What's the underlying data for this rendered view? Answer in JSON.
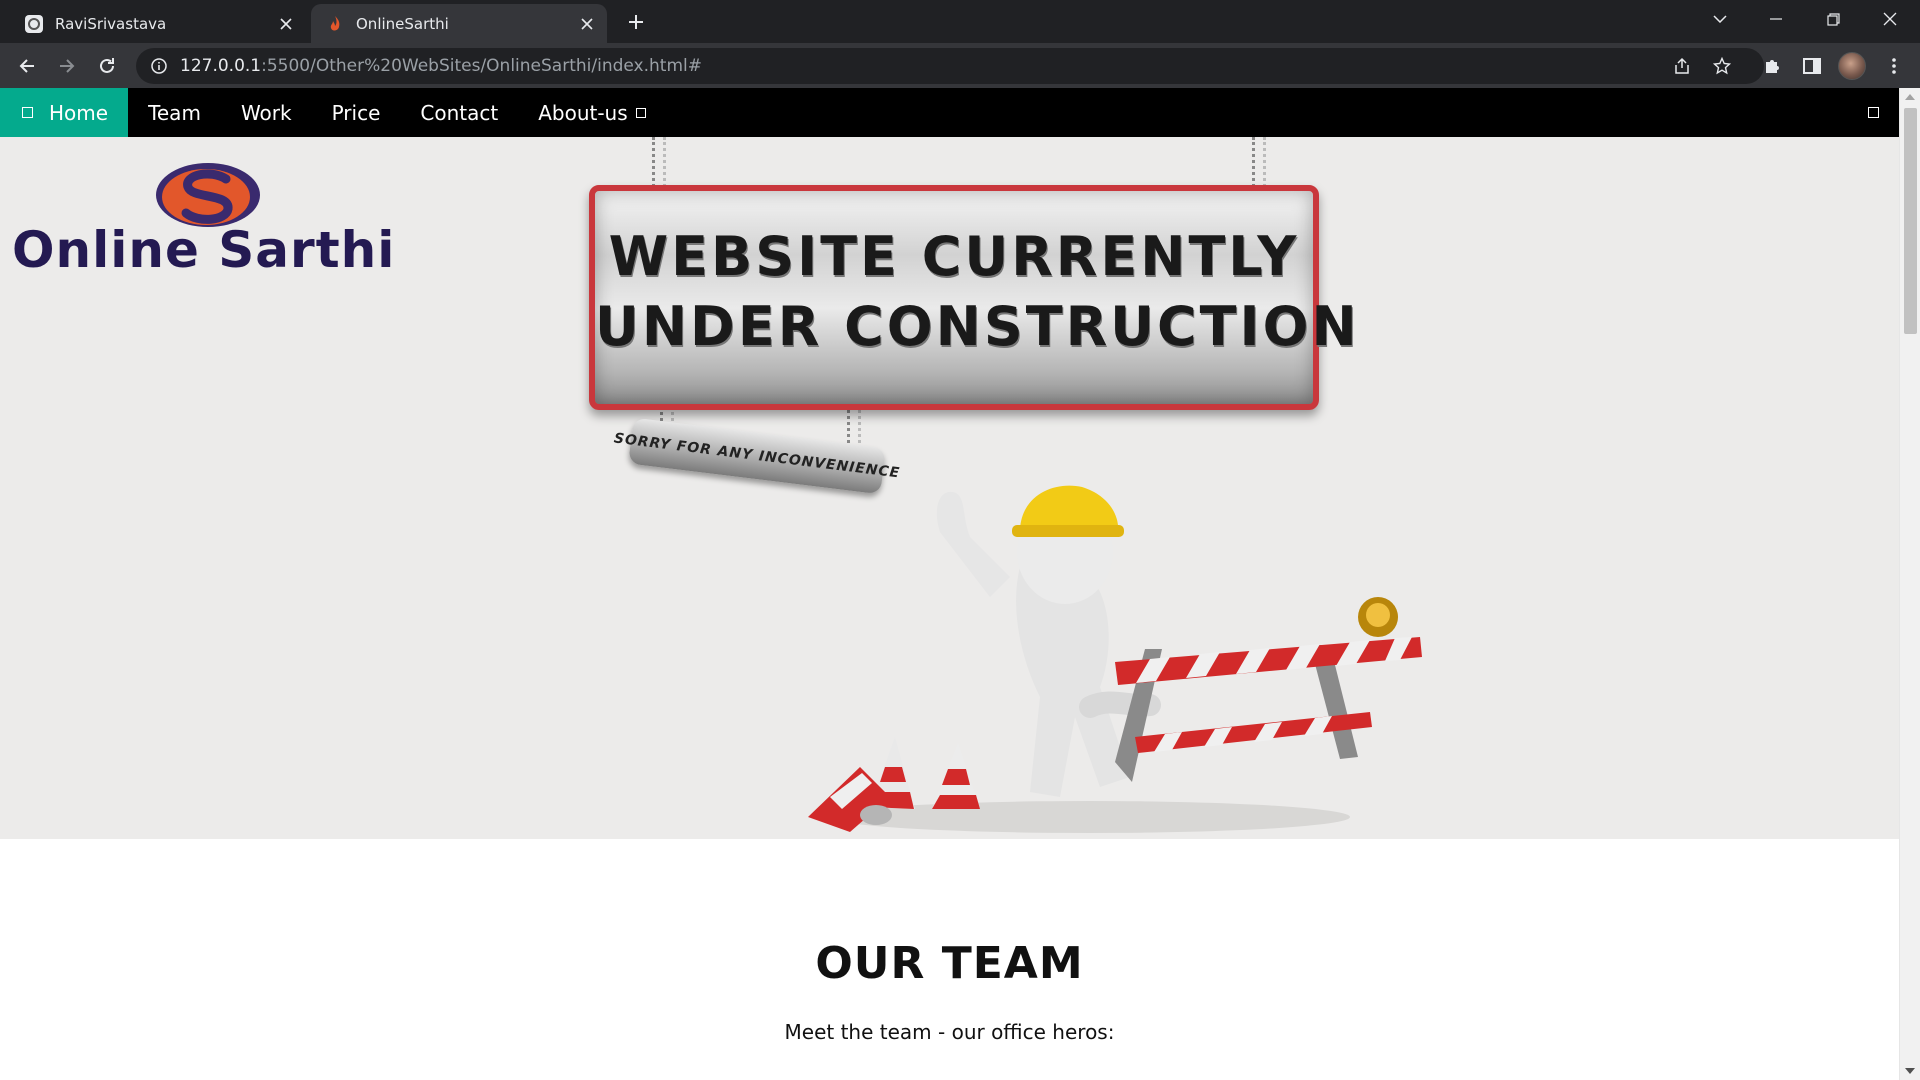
{
  "browser": {
    "tabs": [
      {
        "title": "RaviSrivastava",
        "active": false
      },
      {
        "title": "OnlineSarthi",
        "active": true
      }
    ],
    "url_host": "127.0.0.1",
    "url_path": ":5500/Other%20WebSites/OnlineSarthi/index.html#"
  },
  "site": {
    "nav": {
      "home": "Home",
      "team": "Team",
      "work": "Work",
      "price": "Price",
      "contact": "Contact",
      "about": "About-us"
    },
    "logo_text": "Online Sarthi",
    "hero": {
      "sign_line1": "WEBSITE CURRENTLY",
      "sign_line2": "UNDER CONSTRUCTION",
      "small_sign": "SORRY FOR ANY INCONVENIENCE"
    },
    "team": {
      "title": "OUR TEAM",
      "subtitle": "Meet the team - our office heros:"
    }
  },
  "colors": {
    "nav_bg": "#000000",
    "nav_active": "#04aa8d",
    "hero_bg": "#ecebea",
    "logo_text": "#241a52",
    "sign_border": "#c9373c"
  }
}
